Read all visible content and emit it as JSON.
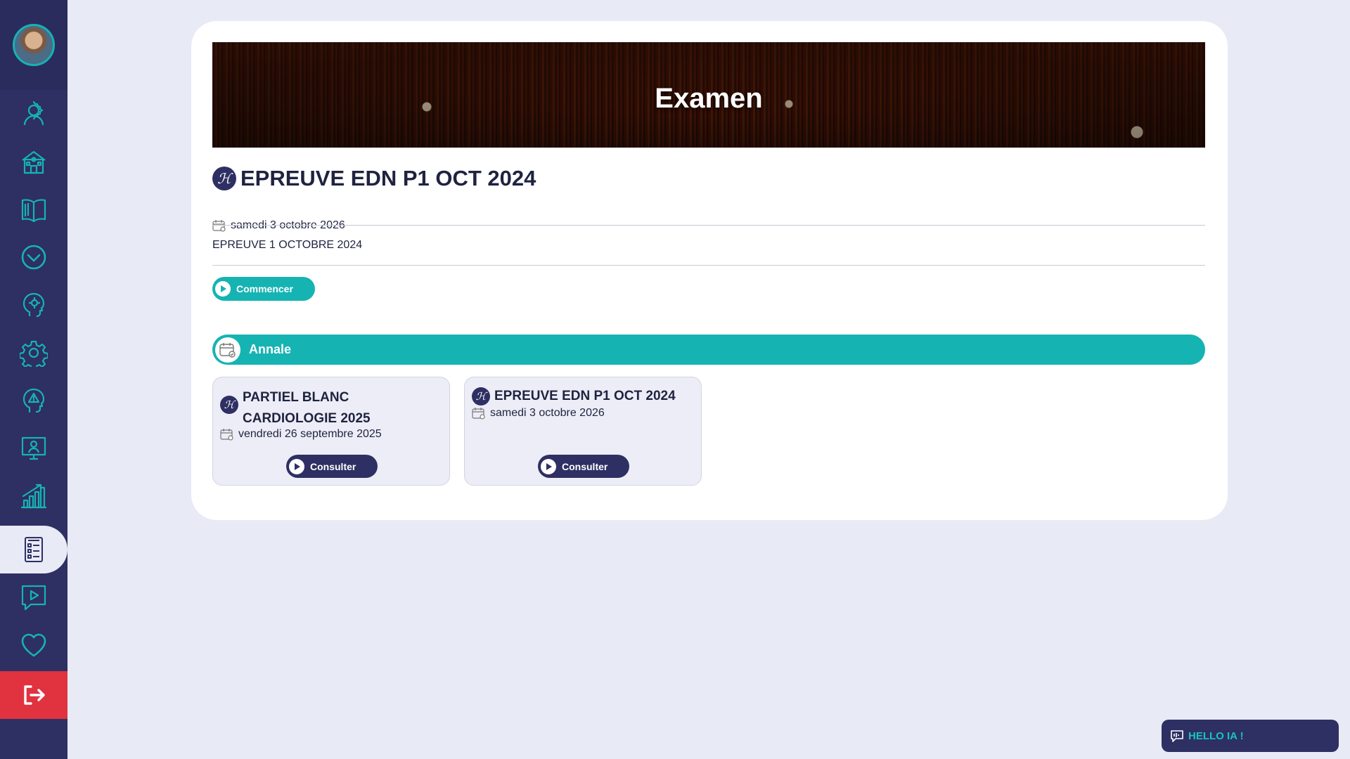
{
  "sidebar": {
    "items": [
      {
        "icon": "user-gear-icon"
      },
      {
        "icon": "school-icon"
      },
      {
        "icon": "book-open-icon"
      },
      {
        "icon": "chevron-circle-down-icon"
      },
      {
        "icon": "head-gear-icon"
      },
      {
        "icon": "gear-icon"
      },
      {
        "icon": "head-alert-icon"
      },
      {
        "icon": "monitor-user-icon"
      },
      {
        "icon": "chart-growth-icon"
      },
      {
        "icon": "checklist-icon",
        "active": true
      },
      {
        "icon": "video-chat-icon"
      },
      {
        "icon": "heart-icon"
      },
      {
        "icon": "logout-icon"
      }
    ]
  },
  "banner": {
    "title": "Examen"
  },
  "exam": {
    "title": "EPREUVE EDN P1 OCT 2024",
    "date": "samedi 3 octobre 2026",
    "description": "EPREUVE 1 OCTOBRE 2024",
    "start_label": "Commencer"
  },
  "section": {
    "label": "Annale"
  },
  "annales": [
    {
      "title_line1": "PARTIEL BLANC",
      "title_line2": "CARDIOLOGIE 2025",
      "date": "vendredi 26 septembre 2025",
      "button": "Consulter"
    },
    {
      "title_line1": "EPREUVE EDN P1 OCT 2024",
      "date": "samedi 3 octobre 2026",
      "button": "Consulter"
    }
  ],
  "chat": {
    "label": "HELLO IA !"
  },
  "colors": {
    "navy": "#2e2f63",
    "teal": "#16b3b3",
    "logout_red": "#e0323f",
    "background": "#e8eaf5"
  }
}
